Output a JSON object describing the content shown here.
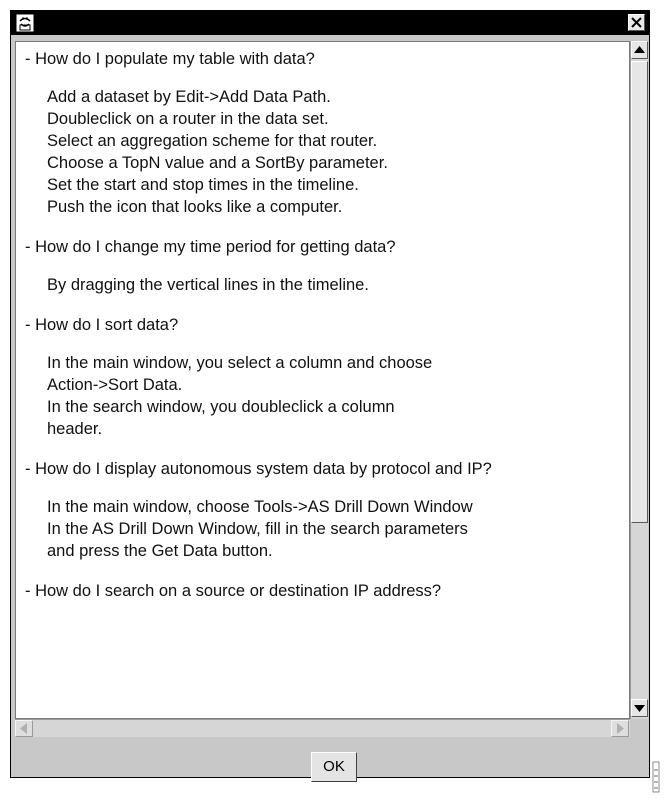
{
  "window": {
    "icons": {
      "app": "app-icon",
      "close": "close-icon"
    }
  },
  "faq": [
    {
      "question": "- How do I populate my table with data?",
      "answers": [
        "Add a dataset by Edit->Add Data Path.",
        "Doubleclick on a router in the data set.",
        "Select an aggregation scheme for that router.",
        "Choose a TopN value and a SortBy parameter.",
        "Set the start and stop times in the timeline.",
        "Push the icon that looks like a computer."
      ]
    },
    {
      "question": "- How do I change my time period for getting data?",
      "answers": [
        "By dragging the vertical lines in the timeline."
      ]
    },
    {
      "question": "- How do I sort data?",
      "answers": [
        "In the main window, you select a column and choose",
        "Action->Sort Data.",
        "In the search window, you doubleclick a column",
        "header."
      ]
    },
    {
      "question": "- How do I display autonomous system data by protocol and IP?",
      "answers": [
        "In the main window, choose Tools->AS Drill Down Window",
        "In the AS Drill Down Window, fill in the search parameters",
        "and press the Get Data button."
      ]
    },
    {
      "question": "- How do I search on a source or destination IP address?",
      "answers": []
    }
  ],
  "buttons": {
    "ok": "OK"
  },
  "scrollbar": {
    "vertical_thumb_fraction": 0.72,
    "vertical_position": 0.0
  },
  "colors": {
    "titlebar": "#000000",
    "window_bg": "#c8c8c8",
    "content_bg": "#ffffff"
  }
}
